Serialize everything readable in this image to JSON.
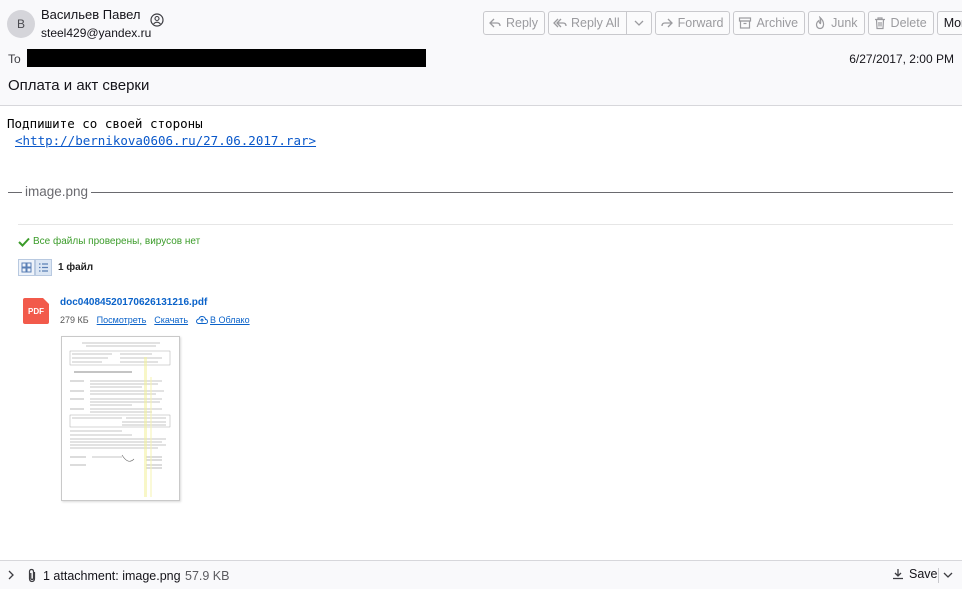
{
  "sender": {
    "avatar_letter": "В",
    "name": "Васильев Павел",
    "email": "steel429@yandex.ru"
  },
  "toolbar": {
    "reply": "Reply",
    "reply_all": "Reply All",
    "forward": "Forward",
    "archive": "Archive",
    "junk": "Junk",
    "delete": "Delete",
    "more": "More"
  },
  "header": {
    "to_label": "To",
    "date": "6/27/2017, 2:00 PM",
    "subject": "Оплата и акт сверки"
  },
  "body": {
    "line1": "Подпишите со своей стороны",
    "link": "<http://bernikova0606.ru/27.06.2017.rar>",
    "fieldset_legend": "image.png"
  },
  "embedded_image": {
    "scan_status": "Все файлы проверены, вирусов нет",
    "files_count": "1 файл",
    "file_icon_label": "PDF",
    "file_name": "doc04084520170626131216.pdf",
    "file_size": "279 КБ",
    "view_link": "Посмотреть",
    "download_link": "Скачать",
    "cloud_link": "В Облако"
  },
  "footer": {
    "attachment_label": "1 attachment: image.png",
    "attachment_size": "57.9 KB",
    "save_label": "Save"
  },
  "colors": {
    "link_blue": "#0a58ca",
    "success_green": "#3b9c2a",
    "pdf_red": "#f25a4b"
  }
}
